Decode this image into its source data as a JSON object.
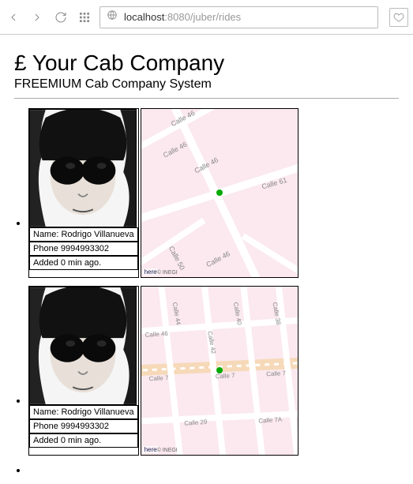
{
  "browser": {
    "url_host": "localhost",
    "url_rest": ":8080/juber/rides"
  },
  "header": {
    "title": "£ Your Cab Company",
    "subtitle": "FREEMIUM Cab Company System"
  },
  "rides": [
    {
      "name_label": "Name: Rodrigo Villanueva",
      "phone_label": "Phone 9994993302",
      "added_label": "Added 0 min ago.",
      "map": {
        "streets": [
          "Calle 46",
          "Calle 46",
          "Calle 46",
          "Calle 61",
          "Calle 50",
          "Calle 46"
        ],
        "credit": "here",
        "credit2": "© INEGI"
      }
    },
    {
      "name_label": "Name: Rodrigo Villanueva",
      "phone_label": "Phone 9994993302",
      "added_label": "Added 0 min ago.",
      "map": {
        "streets": [
          "Calle 44",
          "Calle 40",
          "Calle 38",
          "Calle 42",
          "Calle 46",
          "Calle 7",
          "Calle 7",
          "Calle 7",
          "Calle 29",
          "Calle 7A"
        ],
        "credit": "here",
        "credit2": "© INEGI"
      }
    }
  ]
}
